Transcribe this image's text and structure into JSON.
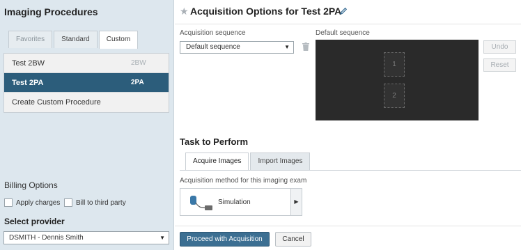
{
  "left": {
    "title": "Imaging Procedures",
    "tabs": [
      {
        "label": "Favorites"
      },
      {
        "label": "Standard"
      },
      {
        "label": "Custom",
        "active": true
      }
    ],
    "procedures": [
      {
        "name": "Test 2BW",
        "code": "2BW",
        "selected": false
      },
      {
        "name": "Test 2PA",
        "code": "2PA",
        "selected": true
      },
      {
        "name": "Create Custom Procedure",
        "code": "",
        "selected": false
      }
    ],
    "billing_title": "Billing Options",
    "apply_charges": "Apply charges",
    "bill_third_party": "Bill to third party",
    "provider_title": "Select provider",
    "provider_value": "DSMITH - Dennis Smith"
  },
  "main": {
    "title": "Acquisition Options for Test 2PA",
    "acq_sequence_label": "Acquisition sequence",
    "acq_sequence_value": "Default sequence",
    "default_sequence_label": "Default sequence",
    "slots": [
      "1",
      "2"
    ],
    "undo_label": "Undo",
    "reset_label": "Reset",
    "task_title": "Task to Perform",
    "task_tabs": [
      {
        "label": "Acquire Images",
        "active": true
      },
      {
        "label": "Import Images"
      }
    ],
    "method_label": "Acquisition method for this imaging exam",
    "method_value": "Simulation",
    "proceed_label": "Proceed with Acquisition",
    "cancel_label": "Cancel"
  },
  "colors": {
    "left_panel_bg": "#dde7ee",
    "selected_row": "#2c5d7b",
    "primary_button": "#3c6f92",
    "sequence_bg": "#2a2a2a"
  }
}
